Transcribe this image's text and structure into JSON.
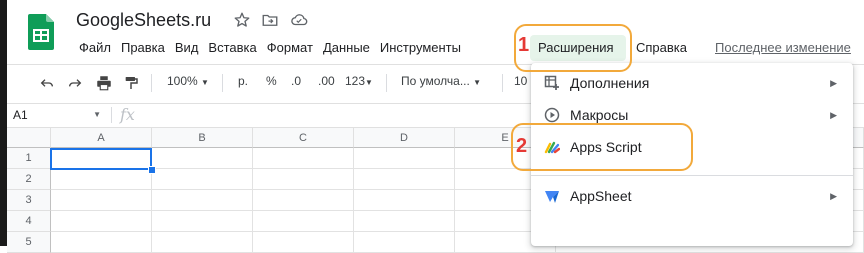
{
  "app": {
    "title": "GoogleSheets.ru",
    "brand_color": "#0f9d58"
  },
  "menubar": {
    "items": [
      "Файл",
      "Правка",
      "Вид",
      "Вставка",
      "Формат",
      "Данные",
      "Инструменты"
    ],
    "active_item": "Расширения",
    "after_active": "Справка",
    "last_change": "Последнее изменение"
  },
  "toolbar": {
    "zoom": "100%",
    "currency": "р.",
    "percent": "%",
    "dec_decrease": ".0",
    "dec_increase": ".00",
    "more_formats": "123",
    "font": "По умолча...",
    "font_size": "10"
  },
  "formula_bar": {
    "cell_ref": "A1",
    "fx": "fx"
  },
  "grid": {
    "columns": [
      "A",
      "B",
      "C",
      "D",
      "E"
    ],
    "rows": [
      "1",
      "2",
      "3",
      "4",
      "5"
    ]
  },
  "dropdown": {
    "items": [
      {
        "label": "Дополнения",
        "icon": "add-ons-icon",
        "has_submenu": true
      },
      {
        "label": "Макросы",
        "icon": "macros-play-icon",
        "has_submenu": true
      },
      {
        "label": "Apps Script",
        "icon": "apps-script-icon",
        "has_submenu": false
      },
      {
        "label": "AppSheet",
        "icon": "appsheet-icon",
        "has_submenu": true
      }
    ]
  },
  "annotations": {
    "step1": "1",
    "step2": "2",
    "ring_color": "#f2a93b",
    "number_color": "#e53935"
  }
}
